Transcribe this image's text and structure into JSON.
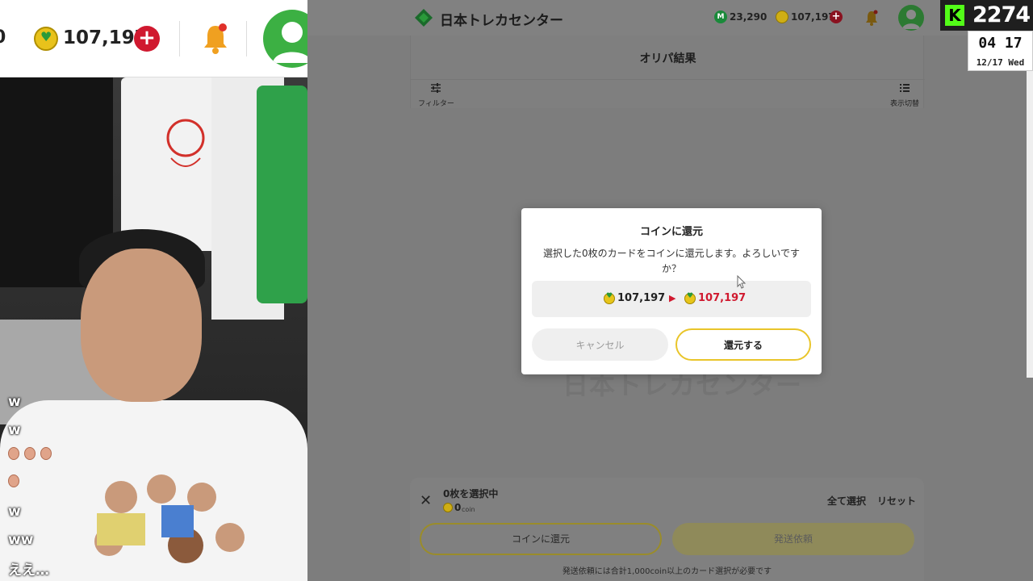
{
  "colors": {
    "accent_yellow": "#e9c52a",
    "coin_gold": "#e7c51a",
    "plus_red": "#d0192f",
    "brand_green": "#2a9a3a",
    "kick_green": "#53fc18"
  },
  "left_header": {
    "cut_text": "0",
    "coin_icon": "heart-coin-icon",
    "coin_amount": "107,197",
    "plus_label": "+"
  },
  "chat": {
    "lines": [
      "w",
      "w",
      "w",
      "ww",
      "ええ…"
    ]
  },
  "header": {
    "site_title": "日本トレカセンター",
    "point_badge": "M",
    "point_amount": "23,290",
    "coin_amount": "107,197",
    "plus_label": "+"
  },
  "results_panel": {
    "title": "オリパ結果",
    "filter_label": "フィルター",
    "view_toggle_label": "表示切替"
  },
  "modal": {
    "title": "コインに還元",
    "message": "選択した0枚のカードをコインに還元します。よろしいですか？",
    "from_amount": "107,197",
    "arrow": "▶",
    "to_amount": "107,197",
    "cancel_label": "キャンセル",
    "confirm_label": "還元する"
  },
  "selection_bar": {
    "close_label": "✕",
    "selected_text": "0枚を選択中",
    "coin_value": "0",
    "coin_unit": "coin",
    "select_all_label": "全て選択",
    "reset_label": "リセット",
    "convert_button_label": "コインに還元",
    "shipping_button_label": "発送依頼",
    "note": "発送依頼には合計1,000coin以上のカード選択が必要です"
  },
  "stream_overlay": {
    "platform_icon": "kick-logo",
    "platform_letter": "K",
    "viewer_count": "2274"
  },
  "clock": {
    "time": "04 17",
    "date": "12/17 Wed"
  }
}
